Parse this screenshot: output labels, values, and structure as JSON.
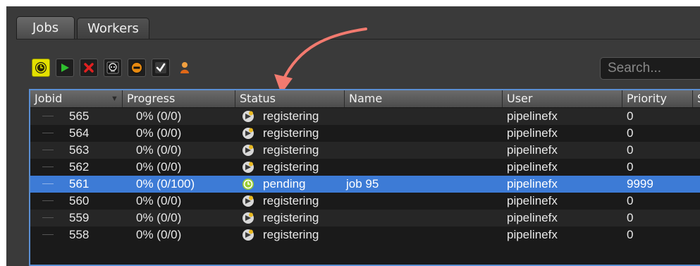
{
  "tabs": [
    {
      "label": "Jobs"
    },
    {
      "label": "Workers"
    }
  ],
  "toolbar": {
    "buttons": [
      {
        "name": "pending-clock-icon"
      },
      {
        "name": "play-icon"
      },
      {
        "name": "kill-x-icon"
      },
      {
        "name": "skull-icon"
      },
      {
        "name": "stop-minus-icon"
      },
      {
        "name": "checkmark-icon"
      },
      {
        "name": "user-icon"
      }
    ]
  },
  "search": {
    "placeholder": "Search..."
  },
  "table": {
    "columns": [
      "Jobid",
      "Progress",
      "Status",
      "Name",
      "User",
      "Priority",
      "S"
    ],
    "rows": [
      {
        "jobid": "565",
        "progress": "0% (0/0)",
        "status": "registering",
        "name": "",
        "user": "pipelinefx",
        "priority": "0",
        "selected": false
      },
      {
        "jobid": "564",
        "progress": "0% (0/0)",
        "status": "registering",
        "name": "",
        "user": "pipelinefx",
        "priority": "0",
        "selected": false
      },
      {
        "jobid": "563",
        "progress": "0% (0/0)",
        "status": "registering",
        "name": "",
        "user": "pipelinefx",
        "priority": "0",
        "selected": false
      },
      {
        "jobid": "562",
        "progress": "0% (0/0)",
        "status": "registering",
        "name": "",
        "user": "pipelinefx",
        "priority": "0",
        "selected": false
      },
      {
        "jobid": "561",
        "progress": "0% (0/100)",
        "status": "pending",
        "name": "job 95",
        "user": "pipelinefx",
        "priority": "9999",
        "selected": true
      },
      {
        "jobid": "560",
        "progress": "0% (0/0)",
        "status": "registering",
        "name": "",
        "user": "pipelinefx",
        "priority": "0",
        "selected": false
      },
      {
        "jobid": "559",
        "progress": "0% (0/0)",
        "status": "registering",
        "name": "",
        "user": "pipelinefx",
        "priority": "0",
        "selected": false
      },
      {
        "jobid": "558",
        "progress": "0% (0/0)",
        "status": "registering",
        "name": "",
        "user": "pipelinefx",
        "priority": "0",
        "selected": false
      }
    ]
  },
  "colors": {
    "selection": "#3d7bd6",
    "annotation_arrow": "#f27a6f",
    "pending_icon": "#9acd32"
  }
}
